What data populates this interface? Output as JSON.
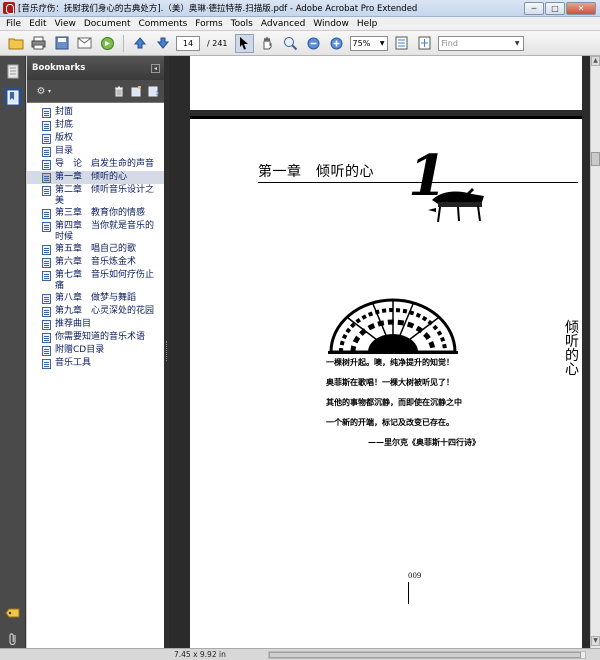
{
  "window": {
    "title": "[音乐疗伤：抚慰我们身心的古典处方].（美）奥琳·德拉特蒂.扫描版.pdf - Adobe Acrobat Pro Extended",
    "minimize": "─",
    "maximize": "□",
    "close": "✕"
  },
  "menu": [
    "File",
    "Edit",
    "View",
    "Document",
    "Comments",
    "Forms",
    "Tools",
    "Advanced",
    "Window",
    "Help"
  ],
  "toolbar": {
    "current_page": "14",
    "total_pages": "/ 241",
    "zoom": "75%",
    "find_placeholder": "Find"
  },
  "bookmarks": {
    "title": "Bookmarks",
    "items": [
      {
        "label": "封面",
        "selected": false
      },
      {
        "label": "封底",
        "selected": false
      },
      {
        "label": "版权",
        "selected": false
      },
      {
        "label": "目录",
        "selected": false
      },
      {
        "label": "导　论　启发生命的声音",
        "selected": false
      },
      {
        "label": "第一章　倾听的心",
        "selected": true
      },
      {
        "label": "第二章　倾听音乐设计之美",
        "selected": false
      },
      {
        "label": "第三章　教育你的情感",
        "selected": false
      },
      {
        "label": "第四章　当你就是音乐的时候",
        "selected": false
      },
      {
        "label": "第五章　唱自己的歌",
        "selected": false
      },
      {
        "label": "第六章　音乐炼金术",
        "selected": false
      },
      {
        "label": "第七章　音乐如何疗伤止痛",
        "selected": false
      },
      {
        "label": "第八章　做梦与舞蹈",
        "selected": false
      },
      {
        "label": "第九章　心灵深处的花园",
        "selected": false
      },
      {
        "label": "推荐曲目",
        "selected": false
      },
      {
        "label": "你需要知道的音乐术语",
        "selected": false
      },
      {
        "label": "附赠CD目录",
        "selected": false
      },
      {
        "label": "音乐工具",
        "selected": false
      }
    ]
  },
  "document": {
    "chapter_title": "第一章　倾听的心",
    "chapter_numeral": "1",
    "side_text": "倾听的心",
    "poem": [
      "一棵树升起。噢，纯净提升的知觉！",
      "奥菲斯在歌唱！一棵大树被听见了！",
      "其他的事物都沉静，而即使在沉静之中",
      "一个新的开端，标记及改变已存在。"
    ],
    "attribution": "——里尔克《奥菲斯十四行诗》",
    "page_number": "009"
  },
  "status": {
    "page_size": "7.45 x 9.92 in"
  }
}
